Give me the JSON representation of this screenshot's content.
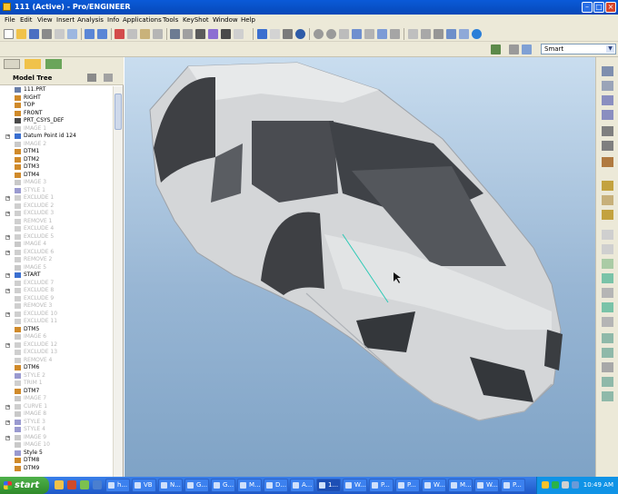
{
  "window": {
    "title": "111 (Active) - Pro/ENGINEER",
    "controls": [
      "minimize",
      "maximize",
      "close"
    ]
  },
  "menu": {
    "items": [
      "File",
      "Edit",
      "View",
      "Insert",
      "Analysis",
      "Info",
      "Applications",
      "Tools",
      "KeyShot",
      "Window",
      "Help"
    ]
  },
  "toolbar": {
    "filter_value": "Smart"
  },
  "model_tree": {
    "header": "Model Tree",
    "items": [
      {
        "label": "111.PRT",
        "icon": "part",
        "dim": false,
        "expand": false
      },
      {
        "label": "RIGHT",
        "icon": "datum-plane",
        "dim": false,
        "expand": false
      },
      {
        "label": "TOP",
        "icon": "datum-plane",
        "dim": false,
        "expand": false
      },
      {
        "label": "FRONT",
        "icon": "datum-plane",
        "dim": false,
        "expand": false
      },
      {
        "label": "PRT_CSYS_DEF",
        "icon": "csys",
        "dim": false,
        "expand": false
      },
      {
        "label": "IMAGE 1",
        "icon": "image",
        "dim": true,
        "expand": false
      },
      {
        "label": "Datum Point id 124",
        "icon": "point",
        "dim": false,
        "expand": true
      },
      {
        "label": "IMAGE 2",
        "icon": "image",
        "dim": true,
        "expand": false
      },
      {
        "label": "DTM1",
        "icon": "datum-plane",
        "dim": false,
        "expand": false
      },
      {
        "label": "DTM2",
        "icon": "datum-plane",
        "dim": false,
        "expand": false
      },
      {
        "label": "DTM3",
        "icon": "datum-plane",
        "dim": false,
        "expand": false
      },
      {
        "label": "DTM4",
        "icon": "datum-plane",
        "dim": false,
        "expand": false
      },
      {
        "label": "IMAGE 3",
        "icon": "image",
        "dim": true,
        "expand": false
      },
      {
        "label": "STYLE 1",
        "icon": "style",
        "dim": true,
        "expand": false
      },
      {
        "label": "EXCLUDE 1",
        "icon": "feature",
        "dim": true,
        "expand": true
      },
      {
        "label": "EXCLUDE 2",
        "icon": "feature",
        "dim": true,
        "expand": false
      },
      {
        "label": "EXCLUDE 3",
        "icon": "feature",
        "dim": true,
        "expand": true
      },
      {
        "label": "REMOVE 1",
        "icon": "feature",
        "dim": true,
        "expand": false
      },
      {
        "label": "EXCLUDE 4",
        "icon": "feature",
        "dim": true,
        "expand": false
      },
      {
        "label": "EXCLUDE 5",
        "icon": "feature",
        "dim": true,
        "expand": true
      },
      {
        "label": "IMAGE 4",
        "icon": "image",
        "dim": true,
        "expand": false
      },
      {
        "label": "EXCLUDE 6",
        "icon": "feature",
        "dim": true,
        "expand": true
      },
      {
        "label": "REMOVE 2",
        "icon": "feature",
        "dim": true,
        "expand": false
      },
      {
        "label": "IMAGE 5",
        "icon": "image",
        "dim": true,
        "expand": false
      },
      {
        "label": "START",
        "icon": "point",
        "dim": false,
        "expand": true
      },
      {
        "label": "EXCLUDE 7",
        "icon": "feature",
        "dim": true,
        "expand": false
      },
      {
        "label": "EXCLUDE 8",
        "icon": "feature",
        "dim": true,
        "expand": true
      },
      {
        "label": "EXCLUDE 9",
        "icon": "feature",
        "dim": true,
        "expand": false
      },
      {
        "label": "REMOVE 3",
        "icon": "feature",
        "dim": true,
        "expand": false
      },
      {
        "label": "EXCLUDE 10",
        "icon": "feature",
        "dim": true,
        "expand": true
      },
      {
        "label": "EXCLUDE 11",
        "icon": "feature",
        "dim": true,
        "expand": false
      },
      {
        "label": "DTM5",
        "icon": "datum-plane",
        "dim": false,
        "expand": false
      },
      {
        "label": "IMAGE 6",
        "icon": "image",
        "dim": true,
        "expand": false
      },
      {
        "label": "EXCLUDE 12",
        "icon": "feature",
        "dim": true,
        "expand": true
      },
      {
        "label": "EXCLUDE 13",
        "icon": "feature",
        "dim": true,
        "expand": false
      },
      {
        "label": "REMOVE 4",
        "icon": "feature",
        "dim": true,
        "expand": false
      },
      {
        "label": "DTM6",
        "icon": "datum-plane",
        "dim": false,
        "expand": false
      },
      {
        "label": "STYLE 2",
        "icon": "style",
        "dim": true,
        "expand": false
      },
      {
        "label": "TRIM 1",
        "icon": "feature",
        "dim": true,
        "expand": false
      },
      {
        "label": "DTM7",
        "icon": "datum-plane",
        "dim": false,
        "expand": false
      },
      {
        "label": "IMAGE 7",
        "icon": "image",
        "dim": true,
        "expand": false
      },
      {
        "label": "CURVE 1",
        "icon": "feature",
        "dim": true,
        "expand": true
      },
      {
        "label": "IMAGE 8",
        "icon": "image",
        "dim": true,
        "expand": false
      },
      {
        "label": "STYLE 3",
        "icon": "style",
        "dim": true,
        "expand": true
      },
      {
        "label": "STYLE 4",
        "icon": "style",
        "dim": true,
        "expand": false
      },
      {
        "label": "IMAGE 9",
        "icon": "image",
        "dim": true,
        "expand": true
      },
      {
        "label": "IMAGE 10",
        "icon": "image",
        "dim": true,
        "expand": false
      },
      {
        "label": "Style 5",
        "icon": "style",
        "dim": false,
        "expand": false
      },
      {
        "label": "DTM8",
        "icon": "datum-plane",
        "dim": false,
        "expand": false
      },
      {
        "label": "DTM9",
        "icon": "datum-plane",
        "dim": false,
        "expand": false
      }
    ]
  },
  "taskbar": {
    "start_label": "start",
    "tasks": [
      "h...",
      "VB",
      "N...",
      "G...",
      "G...",
      "M...",
      "D...",
      "A...",
      "1...",
      "W...",
      "P...",
      "P...",
      "W...",
      "M...",
      "W...",
      "P..."
    ],
    "active_task_index": 8,
    "clock": "10:49 AM"
  },
  "colors": {
    "titlebar": "#0748b8",
    "chrome": "#ece9d8",
    "viewport_top": "#c9ddef",
    "viewport_bottom": "#7fa3c6",
    "model_surface": "#d4d6d8",
    "taskbar": "#1e58c8",
    "start": "#2f8a2a"
  }
}
